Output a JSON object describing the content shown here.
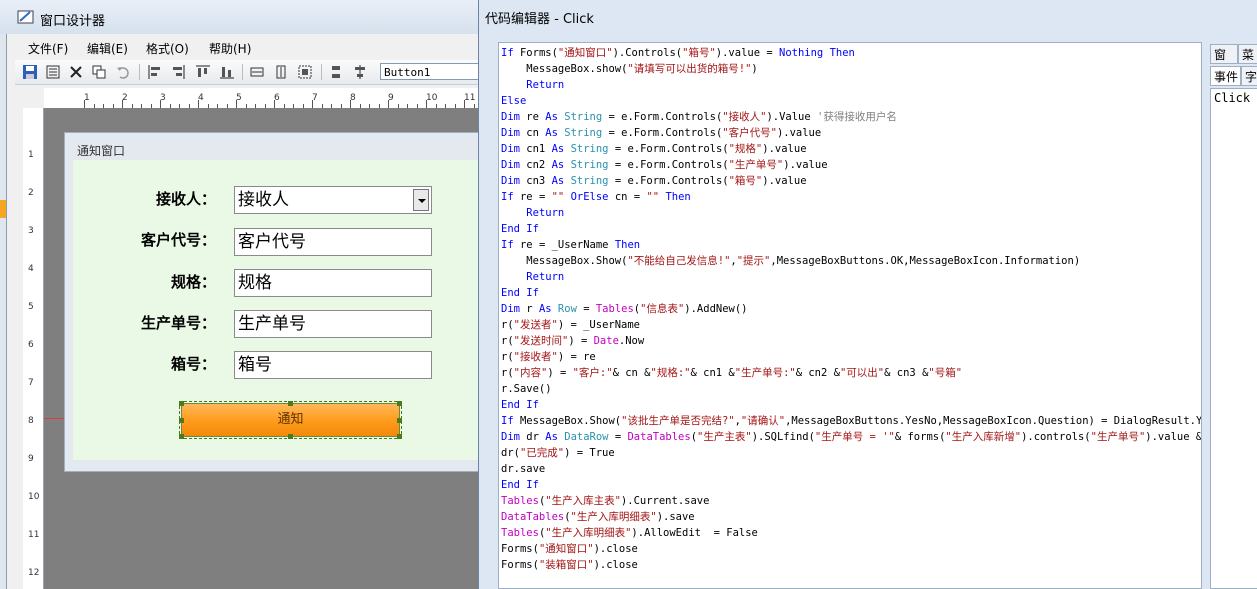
{
  "designer": {
    "title": "窗口设计器",
    "menu": [
      "文件(F)",
      "编辑(E)",
      "格式(O)",
      "帮助(H)"
    ],
    "control_select": "Button1",
    "hruler_nums": [
      "1",
      "2",
      "3",
      "4",
      "5",
      "6",
      "7",
      "8",
      "9",
      "10",
      "11"
    ],
    "vruler_nums": [
      "1",
      "2",
      "3",
      "4",
      "5",
      "6",
      "7",
      "8",
      "9",
      "10",
      "11",
      "12"
    ]
  },
  "form": {
    "title": "通知窗口",
    "fields": [
      {
        "label": "接收人：",
        "value": "接收人"
      },
      {
        "label": "客户代号：",
        "value": "客户代号"
      },
      {
        "label": "规格：",
        "value": "规格"
      },
      {
        "label": "生产单号：",
        "value": "生产单号"
      },
      {
        "label": "箱号：",
        "value": "箱号"
      }
    ],
    "button_label": "通知"
  },
  "editor": {
    "title": "代码编辑器 - Click",
    "tabs": [
      "窗口",
      "菜单",
      "事件",
      "字段"
    ],
    "event_item": "Click",
    "code_lines": [
      "If Forms(\"通知窗口\").Controls(\"箱号\").value = Nothing Then",
      "    MessageBox.show(\"请填写可以出货的箱号!\")",
      "    Return",
      "Else",
      "Dim re As String = e.Form.Controls(\"接收人\").Value '获得接收用户名",
      "Dim cn As String = e.Form.Controls(\"客户代号\").value",
      "Dim cn1 As String = e.Form.Controls(\"规格\").value",
      "Dim cn2 As String = e.Form.Controls(\"生产单号\").value",
      "Dim cn3 As String = e.Form.Controls(\"箱号\").value",
      "If re = \"\" OrElse cn = \"\" Then",
      "    Return",
      "End If",
      "If re = _UserName Then",
      "    MessageBox.Show(\"不能给自己发信息!\",\"提示\",MessageBoxButtons.OK,MessageBoxIcon.Information)",
      "    Return",
      "End If",
      "Dim r As Row = Tables(\"信息表\").AddNew()",
      "r(\"发送者\") = _UserName",
      "r(\"发送时间\") = Date.Now",
      "r(\"接收者\") = re",
      "r(\"内容\") = \"客户:\"& cn &\"规格:\"& cn1 &\"生产单号:\"& cn2 &\"可以出\"& cn3 &\"号箱\"",
      "r.Save()",
      "End If",
      "If MessageBox.Show(\"该批生产单是否完结?\",\"请确认\",MessageBoxButtons.YesNo,MessageBoxIcon.Question) = DialogResult.Yes",
      "Dim dr As DataRow = DataTables(\"生产主表\").SQLfind(\"生产单号 = '\"& forms(\"生产入库新增\").controls(\"生产单号\").value &",
      "dr(\"已完成\") = True",
      "dr.save",
      "End If",
      "Tables(\"生产入库主表\").Current.save",
      "DataTables(\"生产入库明细表\").save",
      "Tables(\"生产入库明细表\").AllowEdit  = False",
      "Forms(\"通知窗口\").close",
      "Forms(\"装箱窗口\").close"
    ]
  },
  "colors": {
    "keyword": "#0000ff",
    "string": "#a31515",
    "comment": "#808080",
    "form_bg": "#eaf9e6",
    "button": "#ff9a1a"
  }
}
